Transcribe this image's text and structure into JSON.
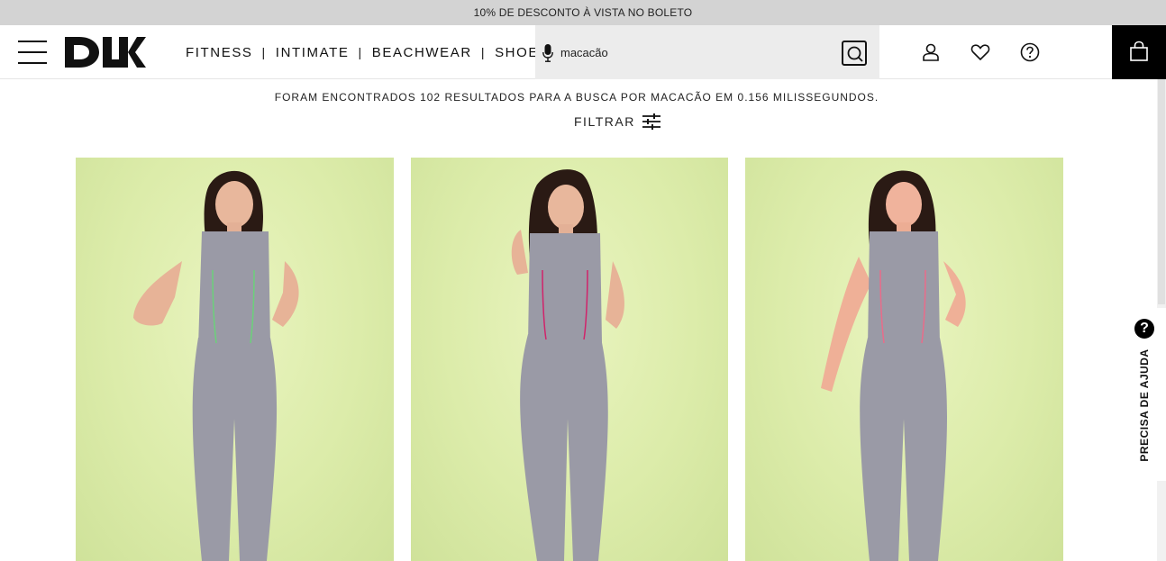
{
  "promo": {
    "text": "10% DE DESCONTO À VISTA NO BOLETO"
  },
  "header": {
    "nav": [
      "FITNESS",
      "INTIMATE",
      "BEACHWEAR",
      "SHOES"
    ],
    "nav_separator": "|",
    "search": {
      "value": "macacão"
    }
  },
  "results": {
    "summary": "FORAM ENCONTRADOS 102 RESULTADOS PARA A BUSCA POR MACACÃO EM 0.156 MILISSEGUNDOS.",
    "filter_label": "FILTRAR"
  },
  "help": {
    "label": "PRECISA DE AJUDA",
    "icon_text": "?"
  },
  "colors": {
    "promo_bg": "#d3d3d3",
    "search_bg": "#ececec",
    "product_bg": "#e8f2b8",
    "garment": "#9a9aa6",
    "accent_black": "#000000"
  }
}
